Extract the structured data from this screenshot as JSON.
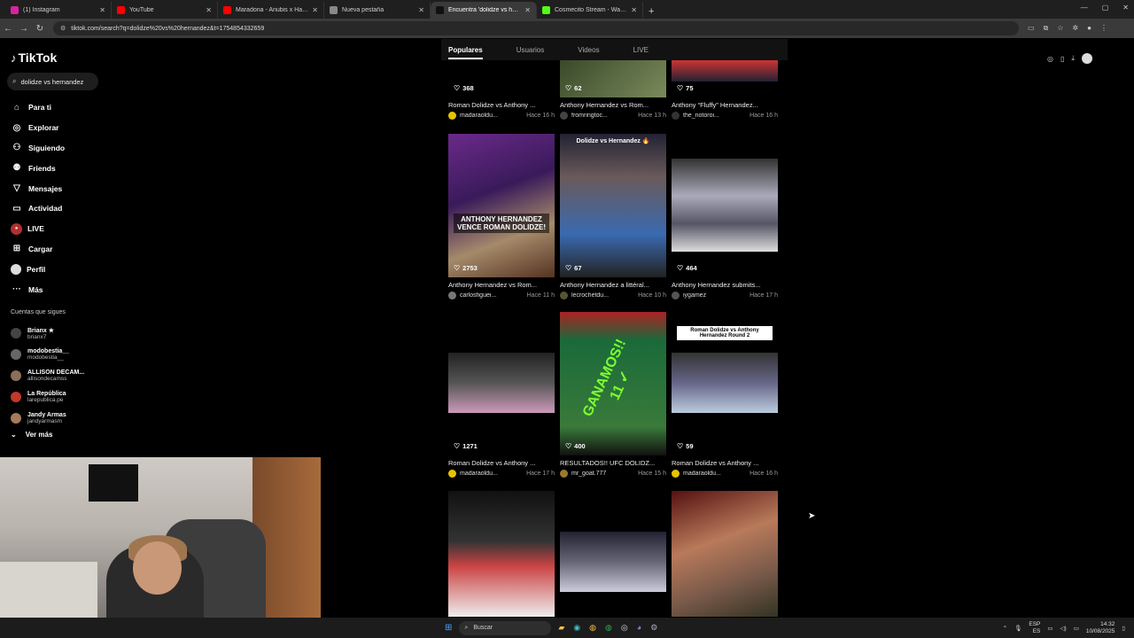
{
  "browser": {
    "tabs": [
      {
        "title": "(1) Instagram",
        "color": "#d6249f"
      },
      {
        "title": "YouTube",
        "color": "#ff0000"
      },
      {
        "title": "Maradona - Anubis x Hades (Vi...",
        "color": "#ff0000"
      },
      {
        "title": "Nueva pestaña",
        "color": "#888888"
      },
      {
        "title": "Encuentra 'dolidze vs hernandez'...",
        "color": "#111111"
      },
      {
        "title": "Cosmecito Stream - Watch Live...",
        "color": "#53fc18"
      }
    ],
    "active_tab": 4,
    "url": "tiktok.com/search?q=dolidze%20vs%20hernandez&t=1754854332659"
  },
  "sidebar": {
    "logo": "TikTok",
    "search_value": "dolidze vs hernandez",
    "nav": [
      {
        "label": "Para ti",
        "icon": "home-icon",
        "glyph": "⌂"
      },
      {
        "label": "Explorar",
        "icon": "compass-icon",
        "glyph": "◎"
      },
      {
        "label": "Siguiendo",
        "icon": "user-follow-icon",
        "glyph": "⚇"
      },
      {
        "label": "Friends",
        "icon": "friends-icon",
        "glyph": "⚉"
      },
      {
        "label": "Mensajes",
        "icon": "messages-icon",
        "glyph": "▽"
      },
      {
        "label": "Actividad",
        "icon": "activity-icon",
        "glyph": "▭"
      },
      {
        "label": "LIVE",
        "icon": "live-icon",
        "glyph": "●"
      },
      {
        "label": "Cargar",
        "icon": "upload-icon",
        "glyph": "⊞"
      },
      {
        "label": "Perfil",
        "icon": "profile-icon",
        "glyph": ""
      },
      {
        "label": "Más",
        "icon": "more-icon",
        "glyph": "···"
      }
    ],
    "following_title": "Cuentas que sigues",
    "following": [
      {
        "name": "Brianx ★",
        "handle": "brianx7",
        "color": "#444"
      },
      {
        "name": "modobestia__",
        "handle": "modobestia__",
        "color": "#666"
      },
      {
        "name": "ALLISON DECAM...",
        "handle": "allisondecamss",
        "color": "#8a6f5a"
      },
      {
        "name": "La República",
        "handle": "larepublica.pe",
        "color": "#c0392b"
      },
      {
        "name": "Jandy Armas",
        "handle": "jandyarmasm",
        "color": "#a57b5c"
      }
    ],
    "ver_mas": "Ver más"
  },
  "results_tabs": [
    "Populares",
    "Usuarios",
    "Videos",
    "LIVE"
  ],
  "videos": [
    {
      "likes": "368",
      "title": "Roman Dolidze vs Anthony ...",
      "author": "madaraoldu...",
      "time": "Hace 16 h",
      "avatar": "#e6c300"
    },
    {
      "likes": "62",
      "title": "Anthony Hernandez vs Rom...",
      "author": "fromringtoc...",
      "time": "Hace 13 h",
      "avatar": "#444"
    },
    {
      "likes": "75",
      "title": "Anthony “Fluffy” Hernandez...",
      "author": "the_notoroi...",
      "time": "Hace 16 h",
      "avatar": "#333"
    },
    {
      "likes": "2753",
      "title": "Anthony Hernandez vs Rom...",
      "author": "carlosfiguei...",
      "time": "Hace 11 h",
      "avatar": "#777",
      "overlay": "ANTHONY HERNANDEZ VENCE ROMAN DOLIDZE!"
    },
    {
      "likes": "67",
      "title": "Anthony Hernandez a littéral...",
      "author": "lecrochetdu...",
      "time": "Hace 10 h",
      "avatar": "#553",
      "overlay": "Dolidze vs Hernandez 🔥"
    },
    {
      "likes": "464",
      "title": "Anthony Hernandez submits...",
      "author": "iygamez",
      "time": "Hace 17 h",
      "avatar": "#555"
    },
    {
      "likes": "1271",
      "title": "Roman Dolidze vs Anthony ...",
      "author": "madaraoldu...",
      "time": "Hace 17 h",
      "avatar": "#e6c300"
    },
    {
      "likes": "400",
      "title": "RESULTADOS!! UFC DOLIDZ...",
      "author": "mr_goat.777",
      "time": "Hace 15 h",
      "avatar": "#9a7b2a",
      "overlay": "GANAMOS!! 11 ✓"
    },
    {
      "likes": "59",
      "title": "Roman Dolidze vs Anthony ...",
      "author": "madaraoldu...",
      "time": "Hace 16 h",
      "avatar": "#e6c300",
      "overlay": "Roman Dolidze vs Anthony Hernandez Round 2"
    },
    {
      "likes": "",
      "title": "",
      "author": "",
      "time": "",
      "avatar": "#000"
    },
    {
      "likes": "",
      "title": "",
      "author": "",
      "time": "",
      "avatar": "#000"
    },
    {
      "likes": "",
      "title": "",
      "author": "",
      "time": "",
      "avatar": "#000"
    }
  ],
  "taskbar": {
    "search": "Buscar",
    "lang1": "ESP",
    "lang2": "ES",
    "time": "14:32",
    "date": "10/08/2025"
  }
}
